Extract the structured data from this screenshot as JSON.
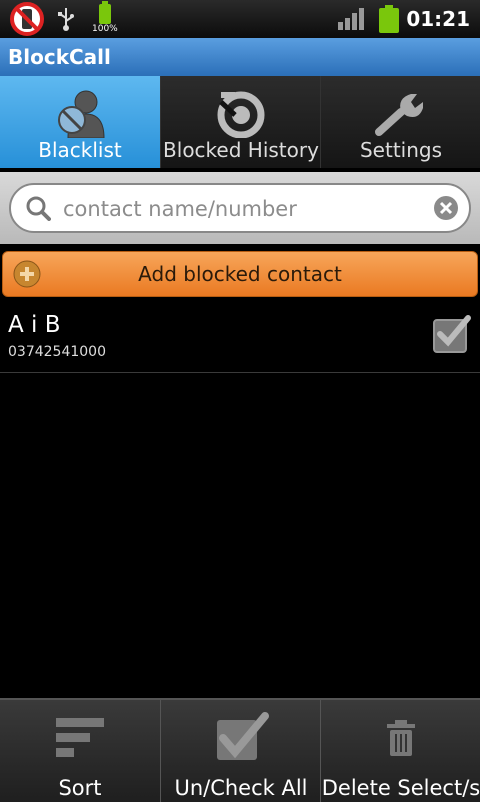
{
  "status_bar": {
    "battery_percent_label": "100%",
    "time": "01:21"
  },
  "app": {
    "title": "BlockCall"
  },
  "tabs": [
    {
      "label": "Blacklist",
      "icon": "blocked-person-icon",
      "active": true
    },
    {
      "label": "Blocked History",
      "icon": "history-icon",
      "active": false
    },
    {
      "label": "Settings",
      "icon": "wrench-icon",
      "active": false
    }
  ],
  "search": {
    "placeholder": "contact name/number",
    "value": ""
  },
  "add_button": {
    "label": "Add blocked contact"
  },
  "contacts": [
    {
      "name": "A i B",
      "number": "03742541000",
      "checked": true
    }
  ],
  "bottom_bar": [
    {
      "label": "Sort",
      "icon": "sort-icon"
    },
    {
      "label": "Un/Check All",
      "icon": "check-all-icon"
    },
    {
      "label": "Delete Select/s",
      "icon": "trash-icon"
    }
  ],
  "colors": {
    "title_bar": "#3f86cf",
    "active_tab": "#3aa0e4",
    "add_button": "#f08c3c",
    "battery": "#7ac70c"
  }
}
